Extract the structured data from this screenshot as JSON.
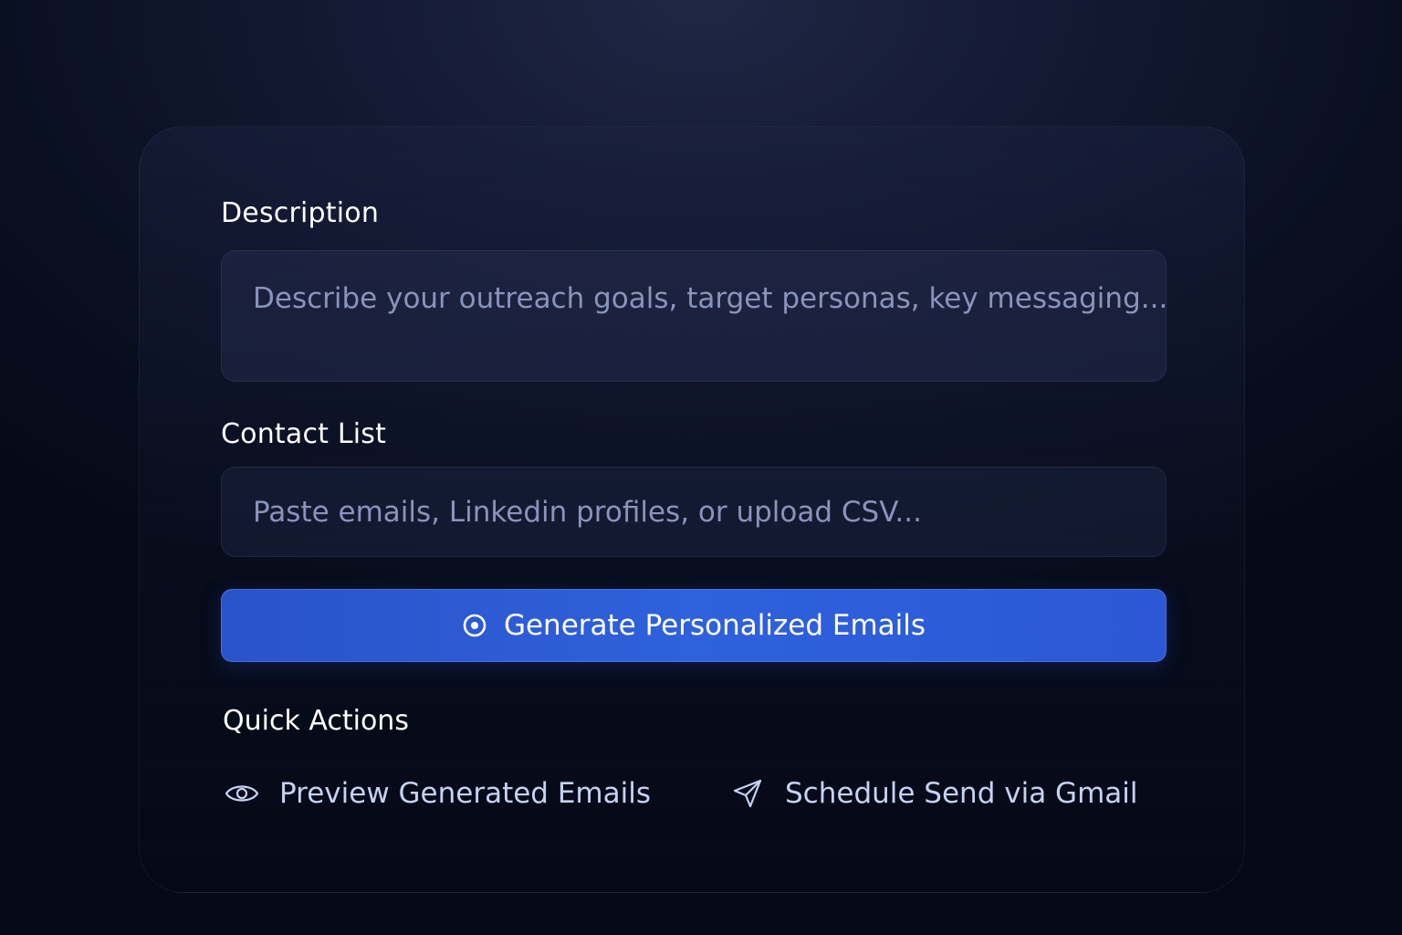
{
  "description": {
    "label": "Description",
    "placeholder": "Describe your outreach goals, target personas, key messaging..."
  },
  "contact_list": {
    "label": "Contact List",
    "placeholder": "Paste emails, Linkedin profiles, or upload CSV..."
  },
  "generate_button": {
    "label": "Generate Personalized Emails",
    "icon": "target-icon"
  },
  "quick_actions": {
    "title": "Quick Actions",
    "items": [
      {
        "label": "Preview Generated Emails",
        "icon": "eye-icon"
      },
      {
        "label": "Schedule Send via Gmail",
        "icon": "send-icon"
      }
    ]
  },
  "colors": {
    "accent": "#2f61dc",
    "background": "#0a0f22",
    "placeholder_text": "#8894ba",
    "action_text": "#c6d2f2"
  }
}
